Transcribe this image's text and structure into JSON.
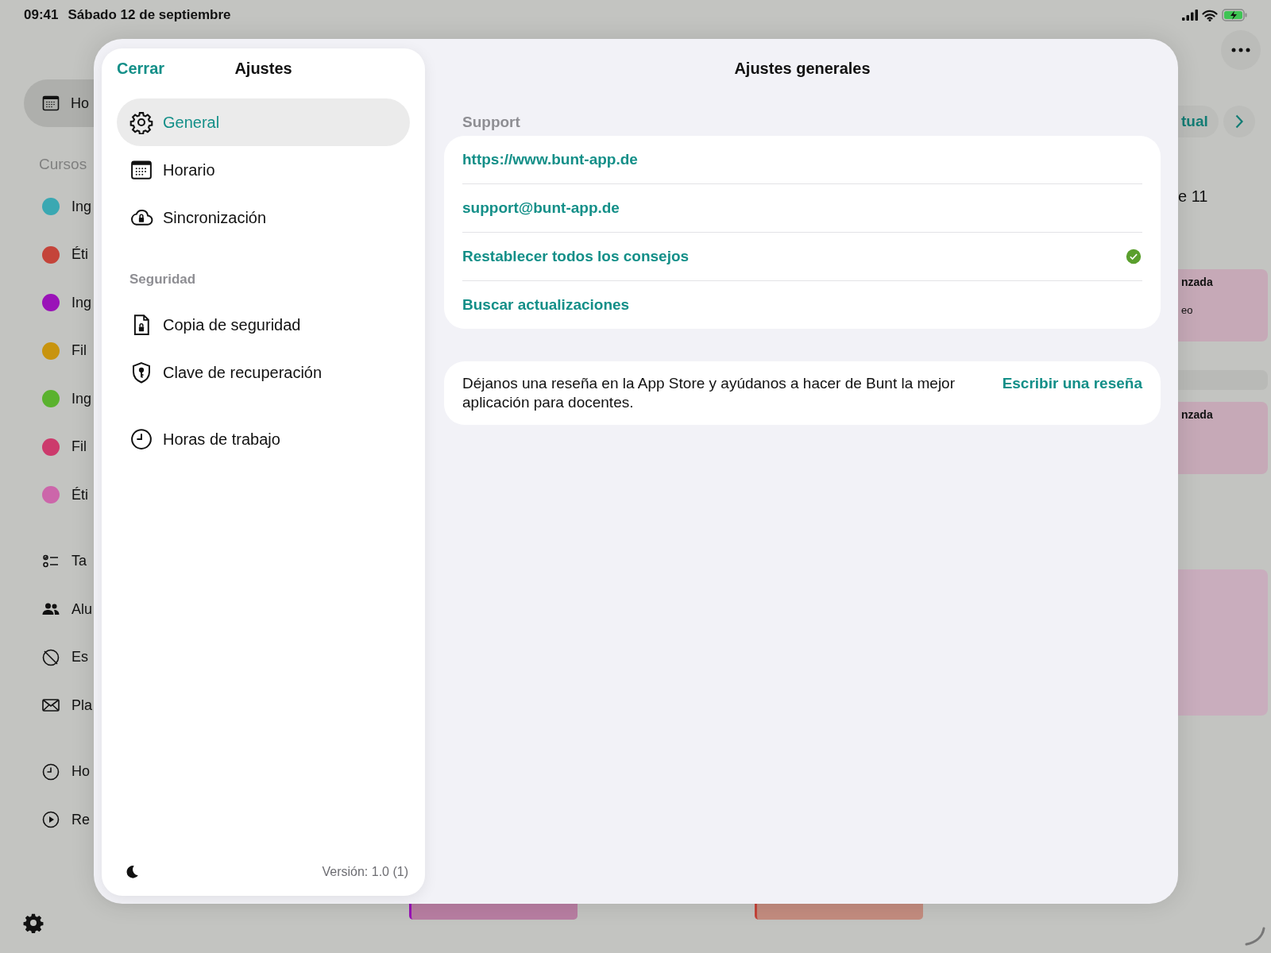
{
  "status_bar": {
    "time": "09:41",
    "date": "Sábado 12 de septiembre"
  },
  "app": {
    "sidebar": {
      "top_item": {
        "label": "Ho",
        "selected": true
      },
      "courses_header": "Cursos",
      "courses": [
        {
          "label": "Ing",
          "color": "#3aa8b2"
        },
        {
          "label": "Éti",
          "color": "#c4443a"
        },
        {
          "label": "Ing",
          "color": "#9a12b8"
        },
        {
          "label": "Fil",
          "color": "#c8940e"
        },
        {
          "label": "Ing",
          "color": "#5ab22e"
        },
        {
          "label": "Fil",
          "color": "#cc3a6c"
        },
        {
          "label": "Éti",
          "color": "#cc66aa"
        }
      ],
      "tools": [
        {
          "label": "Ta"
        },
        {
          "label": "Alu"
        },
        {
          "label": "Es"
        },
        {
          "label": "Pla"
        }
      ],
      "more": [
        {
          "label": "Ho"
        },
        {
          "label": "Re"
        }
      ]
    },
    "toolbar": {
      "today_button": "tual"
    },
    "day": {
      "heading": "e 11",
      "events": [
        {
          "title": "nzada",
          "subtitle": "eo"
        },
        {
          "title": "nzada"
        }
      ]
    },
    "bottom_events": [
      {
        "color": "#9a12b8"
      },
      {
        "color": "#c4443a"
      }
    ]
  },
  "settings": {
    "close": "Cerrar",
    "title": "Ajustes",
    "nav": {
      "sections": [
        {
          "items": [
            {
              "label": "General",
              "selected": true
            },
            {
              "label": "Horario",
              "selected": false
            },
            {
              "label": "Sincronización",
              "selected": false
            }
          ]
        },
        {
          "header": "Seguridad",
          "items": [
            {
              "label": "Copia de seguridad",
              "selected": false
            },
            {
              "label": "Clave de recuperación",
              "selected": false
            }
          ]
        },
        {
          "items": [
            {
              "label": "Horas de trabajo",
              "selected": false
            }
          ]
        }
      ]
    },
    "version": "Versión: 1.0 (1)",
    "detail": {
      "title": "Ajustes generales",
      "section": "Support",
      "rows": [
        {
          "label": "https://www.bunt-app.de",
          "done": false
        },
        {
          "label": "support@bunt-app.de",
          "done": false
        },
        {
          "label": "Restablecer todos los consejos",
          "done": true
        },
        {
          "label": "Buscar actualizaciones",
          "done": false
        }
      ],
      "review": {
        "text": "Déjanos una reseña en la App Store y ayúdanos a hacer de Bunt la mejor aplicación para docentes.",
        "button": "Escribir una reseña"
      }
    }
  }
}
